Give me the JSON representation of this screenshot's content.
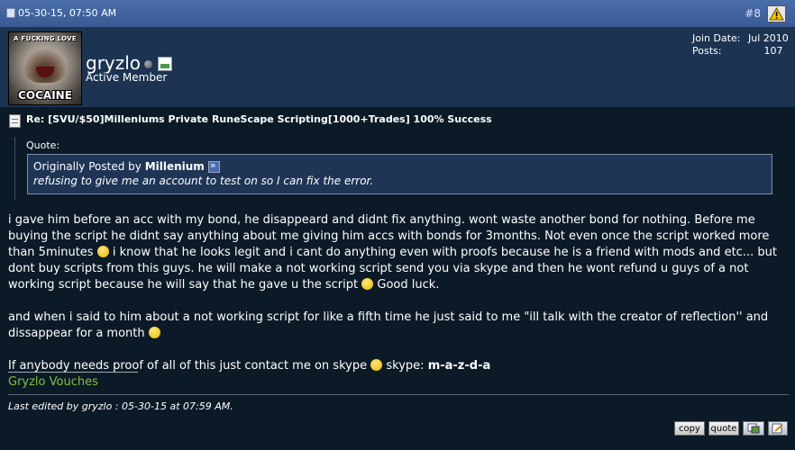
{
  "header": {
    "date": "05-30-15, 07:50 AM",
    "post_number": "#8"
  },
  "user": {
    "name": "gryzlo",
    "title": "Active Member",
    "avatar_top_text": "A FUCKING LOVE",
    "avatar_bottom_text": "COCAINE",
    "join_date_label": "Join Date:",
    "join_date_value": "Jul 2010",
    "posts_label": "Posts:",
    "posts_value": "107"
  },
  "post": {
    "title": "Re: [SVU/$50]Milleniums Private RuneScape Scripting[1000+Trades] 100% Success",
    "quote": {
      "label": "Quote:",
      "originally_posted_by": "Originally Posted by",
      "author": "Millenium",
      "text": "refusing to give me an account to test on so I can fix the error."
    },
    "paragraph1_a": "i gave him before an acc with my bond, he disappeard and didnt fix anything. wont waste another bond for nothing. Before me buying the script he didnt say anything about me giving him accs with bonds for 3months. Not even once the script worked more than 5minutes",
    "paragraph1_b": "i know that he looks legit and i cant do anything even with proofs because he is a friend with mods and etc... but dont buy scripts from this guys. he will make a not working script send you via skype and then he wont refund u guys of a not working script because he will say that he gave u the script",
    "paragraph1_c": "Good luck.",
    "paragraph2": "and when i said to him about a not working script for like a fifth time he just said to me \"ill talk with the creator of reflection'' and dissappear for a month",
    "paragraph3_a": "If anybody needs proof of all of this just contact me on skype",
    "paragraph3_b": "skype:",
    "skype_id": "m-a-z-d-a",
    "signature": "Gryzlo Vouches",
    "last_edited": "Last edited by gryzlo : 05-30-15 at 07:59 AM."
  },
  "buttons": {
    "copy": "copy",
    "quote": "quote"
  },
  "icons": {
    "report": "warning-icon",
    "multiquote": "multiquote-icon",
    "edit": "edit-icon"
  },
  "colors": {
    "header_bar": "#3a5a94",
    "user_panel": "#1c3452",
    "body_bg": "#0c1a28",
    "signature": "#7fc23a"
  }
}
